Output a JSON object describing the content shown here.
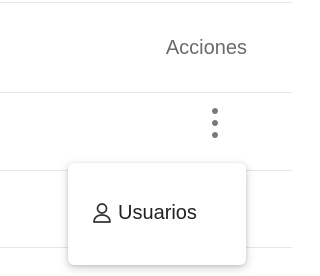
{
  "table": {
    "actions_header": "Acciones"
  },
  "row_actions": {
    "more_icon": "more-vertical-icon"
  },
  "menu": {
    "items": [
      {
        "label": "Usuarios",
        "icon": "user-icon"
      }
    ]
  }
}
